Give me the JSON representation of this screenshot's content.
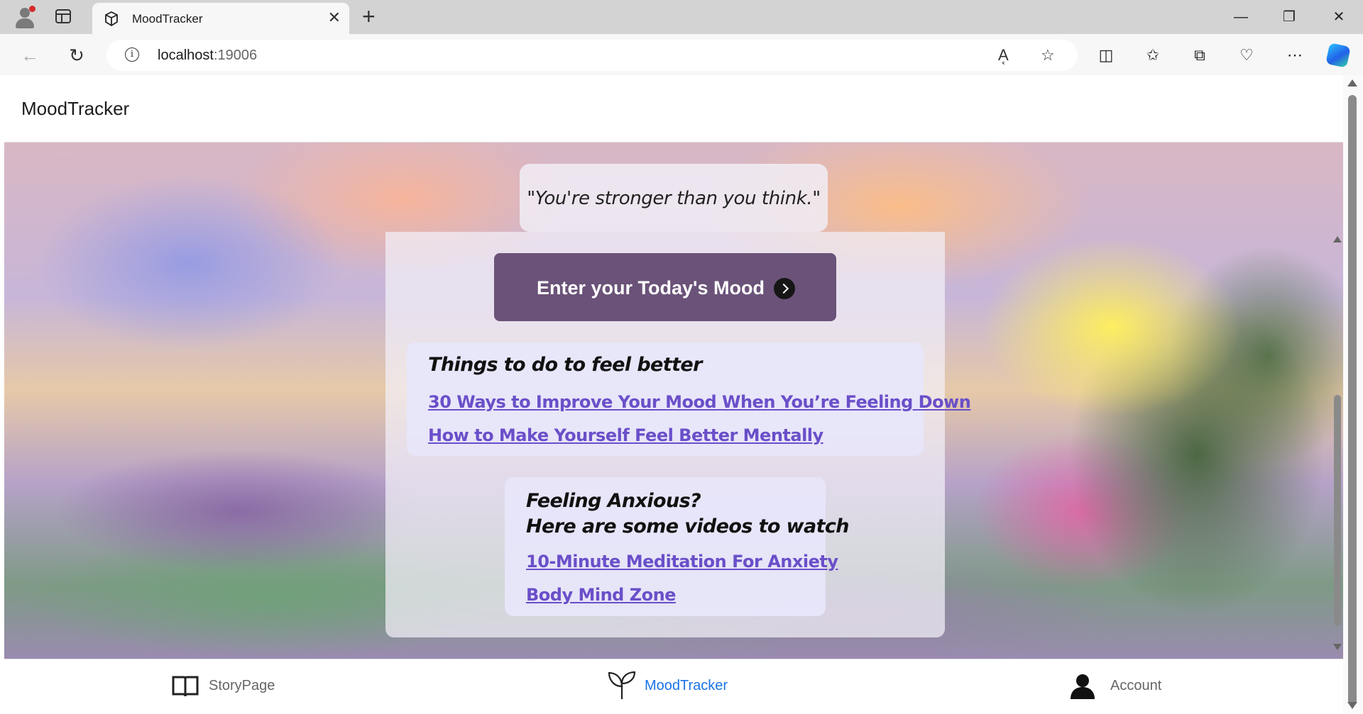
{
  "browser": {
    "tab_title": "MoodTracker",
    "url_host": "localhost",
    "url_port": ":19006"
  },
  "app": {
    "header_title": "MoodTracker"
  },
  "quote": {
    "text": "\"You're stronger than you think.\""
  },
  "mood_button": {
    "label": "Enter your Today's Mood"
  },
  "feel_better": {
    "title": "Things to do to feel better",
    "links": [
      "30 Ways to Improve Your Mood When You’re Feeling Down",
      "How to Make Yourself Feel Better Mentally"
    ]
  },
  "anxious": {
    "title_line1": "Feeling Anxious?",
    "title_line2": "Here are some videos to watch",
    "links": [
      "10-Minute Meditation For Anxiety",
      "Body Mind Zone"
    ]
  },
  "bottom_nav": {
    "items": [
      {
        "label": "StoryPage",
        "icon": "book-icon",
        "active": false
      },
      {
        "label": "MoodTracker",
        "icon": "sprout-icon",
        "active": true
      },
      {
        "label": "Account",
        "icon": "person-icon",
        "active": false
      }
    ],
    "active_color": "#1a73e8",
    "inactive_color": "#666666"
  },
  "colors": {
    "mood_button_bg": "#6a5278",
    "link_color": "#6a4fc9",
    "card_bg": "#e8e6fa"
  }
}
